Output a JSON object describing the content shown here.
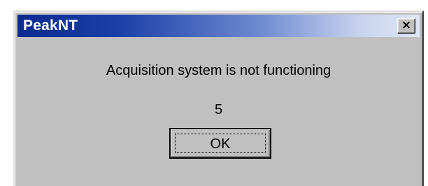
{
  "window": {
    "title": "PeakNT",
    "close_label": "×"
  },
  "dialog": {
    "message": "Acquisition system is not functioning",
    "code": "5",
    "ok_label": "OK"
  }
}
